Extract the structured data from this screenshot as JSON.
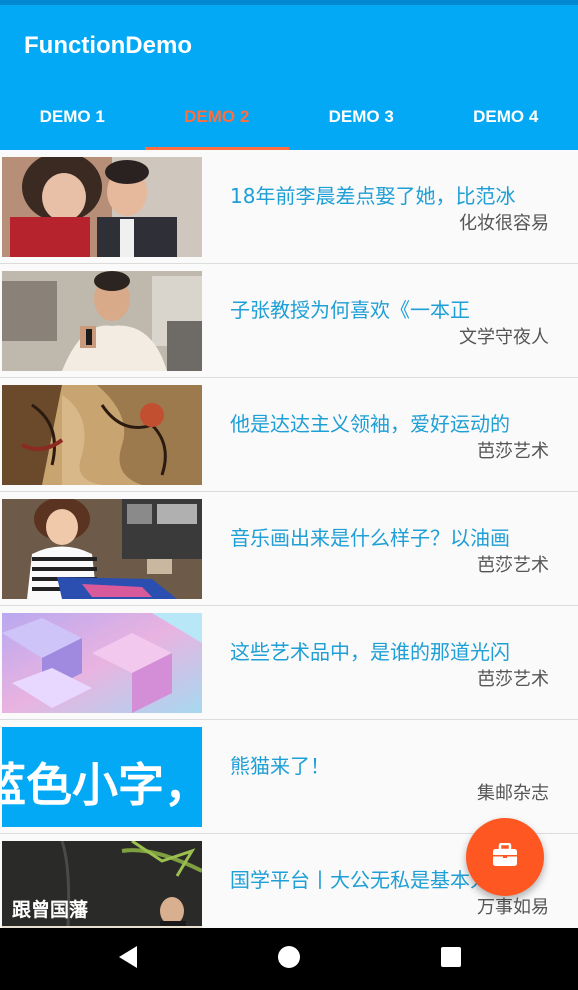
{
  "app": {
    "title": "FunctionDemo"
  },
  "tabs": [
    {
      "label": "DEMO 1"
    },
    {
      "label": "DEMO 2",
      "active": true
    },
    {
      "label": "DEMO 3"
    },
    {
      "label": "DEMO 4"
    }
  ],
  "articles": [
    {
      "title": "18年前李晨差点娶了她，比范冰",
      "source": "化妆很容易",
      "image": "couple-photo"
    },
    {
      "title": "子张教授为何喜欢《一本正",
      "source": "文学守夜人",
      "image": "speaker-photo"
    },
    {
      "title": "他是达达主义领袖，爱好运动的",
      "source": "芭莎艺术",
      "image": "painting"
    },
    {
      "title": "音乐画出来是什么样子？以油画",
      "source": "芭莎艺术",
      "image": "artist-photo"
    },
    {
      "title": "这些艺术品中，是谁的那道光闪",
      "source": "芭莎艺术",
      "image": "abstract-art"
    },
    {
      "title": "熊猫来了！",
      "source": "集邮杂志",
      "image": "text-banner",
      "image_text": "蓝色小字，"
    },
    {
      "title": "国学平台丨大公无私是基本人",
      "source": "万事如易",
      "image": "zeng-guofan",
      "image_text": "跟曾国藩"
    }
  ],
  "fab": {
    "icon": "briefcase-icon"
  },
  "navigation": {
    "back": "back-icon",
    "home": "home-icon",
    "recents": "recents-icon"
  },
  "colors": {
    "primary": "#03a9f4",
    "primary_dark": "#0288d1",
    "accent": "#ff5722",
    "tab_selected": "#ff6e40",
    "title_text": "#1e9fd6"
  }
}
